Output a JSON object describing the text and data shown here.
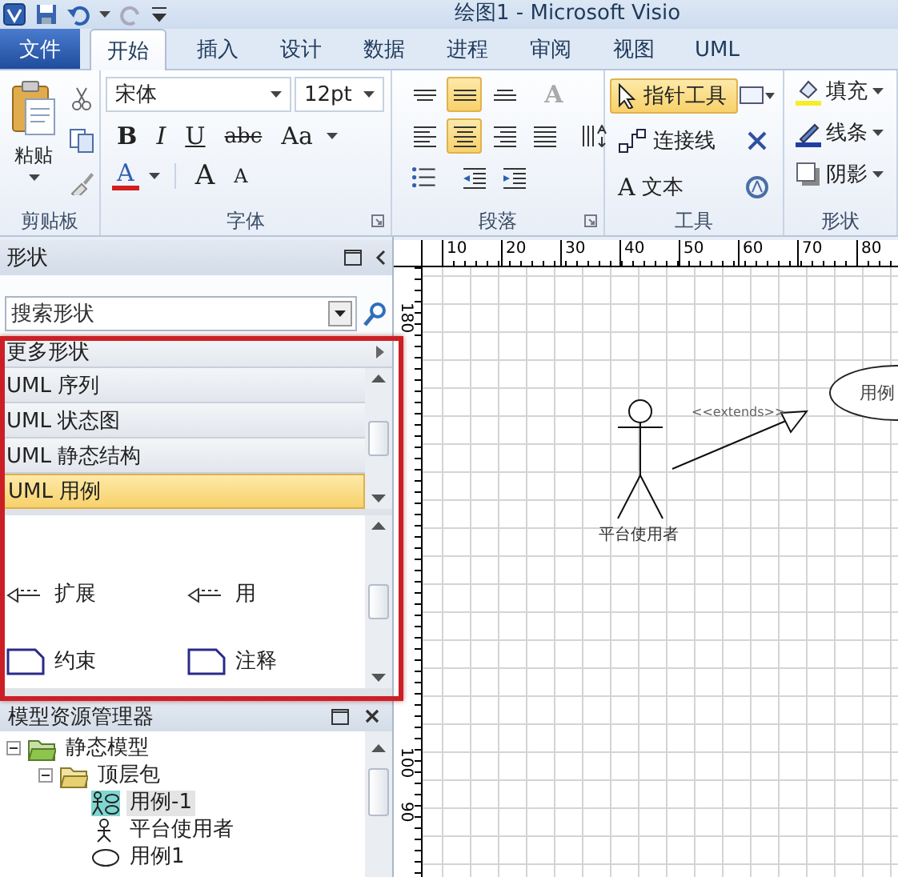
{
  "window": {
    "title": "绘图1 - Microsoft Visio"
  },
  "ribbon_tabs": [
    {
      "label": "文件",
      "kind": "file",
      "selected": false
    },
    {
      "label": "开始",
      "kind": "tab",
      "selected": true
    },
    {
      "label": "插入",
      "kind": "tab",
      "selected": false
    },
    {
      "label": "设计",
      "kind": "tab",
      "selected": false
    },
    {
      "label": "数据",
      "kind": "tab",
      "selected": false
    },
    {
      "label": "进程",
      "kind": "tab",
      "selected": false
    },
    {
      "label": "审阅",
      "kind": "tab",
      "selected": false
    },
    {
      "label": "视图",
      "kind": "tab",
      "selected": false
    },
    {
      "label": "UML",
      "kind": "tab",
      "selected": false
    }
  ],
  "ribbon": {
    "clipboard": {
      "label": "剪贴板",
      "paste": "粘贴"
    },
    "font": {
      "label": "字体",
      "font_name": "宋体",
      "font_size": "12pt",
      "format_buttons": [
        {
          "kind": "bold",
          "glyph": "B"
        },
        {
          "kind": "italic",
          "glyph": "I"
        },
        {
          "kind": "underline",
          "glyph": "U"
        },
        {
          "kind": "strikethrough",
          "glyph": "abc"
        },
        {
          "kind": "case",
          "glyph": "Aa"
        }
      ],
      "size_buttons": [
        {
          "kind": "color",
          "glyph": "A"
        },
        {
          "kind": "grow",
          "glyph": "A"
        },
        {
          "kind": "shrink",
          "glyph": "A"
        }
      ]
    },
    "paragraph": {
      "label": "段落",
      "rows": [
        [
          {
            "kind": "align-top",
            "selected": false
          },
          {
            "kind": "align-middle",
            "selected": true
          },
          {
            "kind": "align-bottom",
            "selected": false
          },
          {
            "kind": "text-direction",
            "glyph": "A",
            "selected": false
          }
        ],
        [
          {
            "kind": "align-left",
            "selected": false
          },
          {
            "kind": "align-center",
            "selected": true
          },
          {
            "kind": "align-right",
            "selected": false
          },
          {
            "kind": "justify",
            "selected": false
          },
          {
            "kind": "vertical-text",
            "selected": false
          }
        ],
        [
          {
            "kind": "bullets",
            "selected": false
          },
          {
            "kind": "decrease-indent",
            "selected": false
          },
          {
            "kind": "increase-indent",
            "selected": false
          }
        ]
      ]
    },
    "tools": {
      "label": "工具",
      "items": [
        {
          "kind": "pointer",
          "label": "指针工具",
          "selected": true
        },
        {
          "kind": "connector",
          "label": "连接线",
          "selected": false
        },
        {
          "kind": "text",
          "glyph": "A",
          "label": "文本",
          "selected": false
        }
      ]
    },
    "shape": {
      "label": "形状",
      "items": [
        {
          "kind": "fill",
          "label": "填充"
        },
        {
          "kind": "line",
          "label": "线条"
        },
        {
          "kind": "shadow",
          "label": "阴影"
        }
      ]
    }
  },
  "shapes_panel": {
    "title": "形状",
    "search": {
      "placeholder": "搜索形状"
    },
    "more_shapes": "更多形状",
    "stencils": [
      {
        "label": "UML 序列",
        "selected": false
      },
      {
        "label": "UML 状态图",
        "selected": false
      },
      {
        "label": "UML 静态结构",
        "selected": false
      },
      {
        "label": "UML 用例",
        "selected": true
      }
    ],
    "masters": [
      {
        "kind": "extends",
        "label": "扩展"
      },
      {
        "kind": "extends",
        "label": "用"
      },
      {
        "kind": "note",
        "label": "约束"
      },
      {
        "kind": "note",
        "label": "注释"
      }
    ]
  },
  "model_explorer": {
    "title": "模型资源管理器",
    "tree": [
      {
        "label": "静态模型",
        "kind": "model",
        "expanded": true,
        "selected": false,
        "children": [
          {
            "label": "顶层包",
            "kind": "package",
            "expanded": true,
            "selected": false,
            "children": [
              {
                "label": "用例-1",
                "kind": "diagram",
                "selected": true
              },
              {
                "label": "平台使用者",
                "kind": "actor",
                "selected": false
              },
              {
                "label": "用例1",
                "kind": "usecase",
                "selected": false
              }
            ]
          }
        ]
      }
    ]
  },
  "canvas": {
    "top_ruler": [
      "10",
      "20",
      "30",
      "40",
      "50",
      "60",
      "70",
      "80"
    ],
    "left_ruler": [
      "180",
      "100",
      "90"
    ],
    "diagram": {
      "actor_label": "平台使用者",
      "connector_label": "<<extends>>",
      "use_case_label": "用例"
    }
  }
}
